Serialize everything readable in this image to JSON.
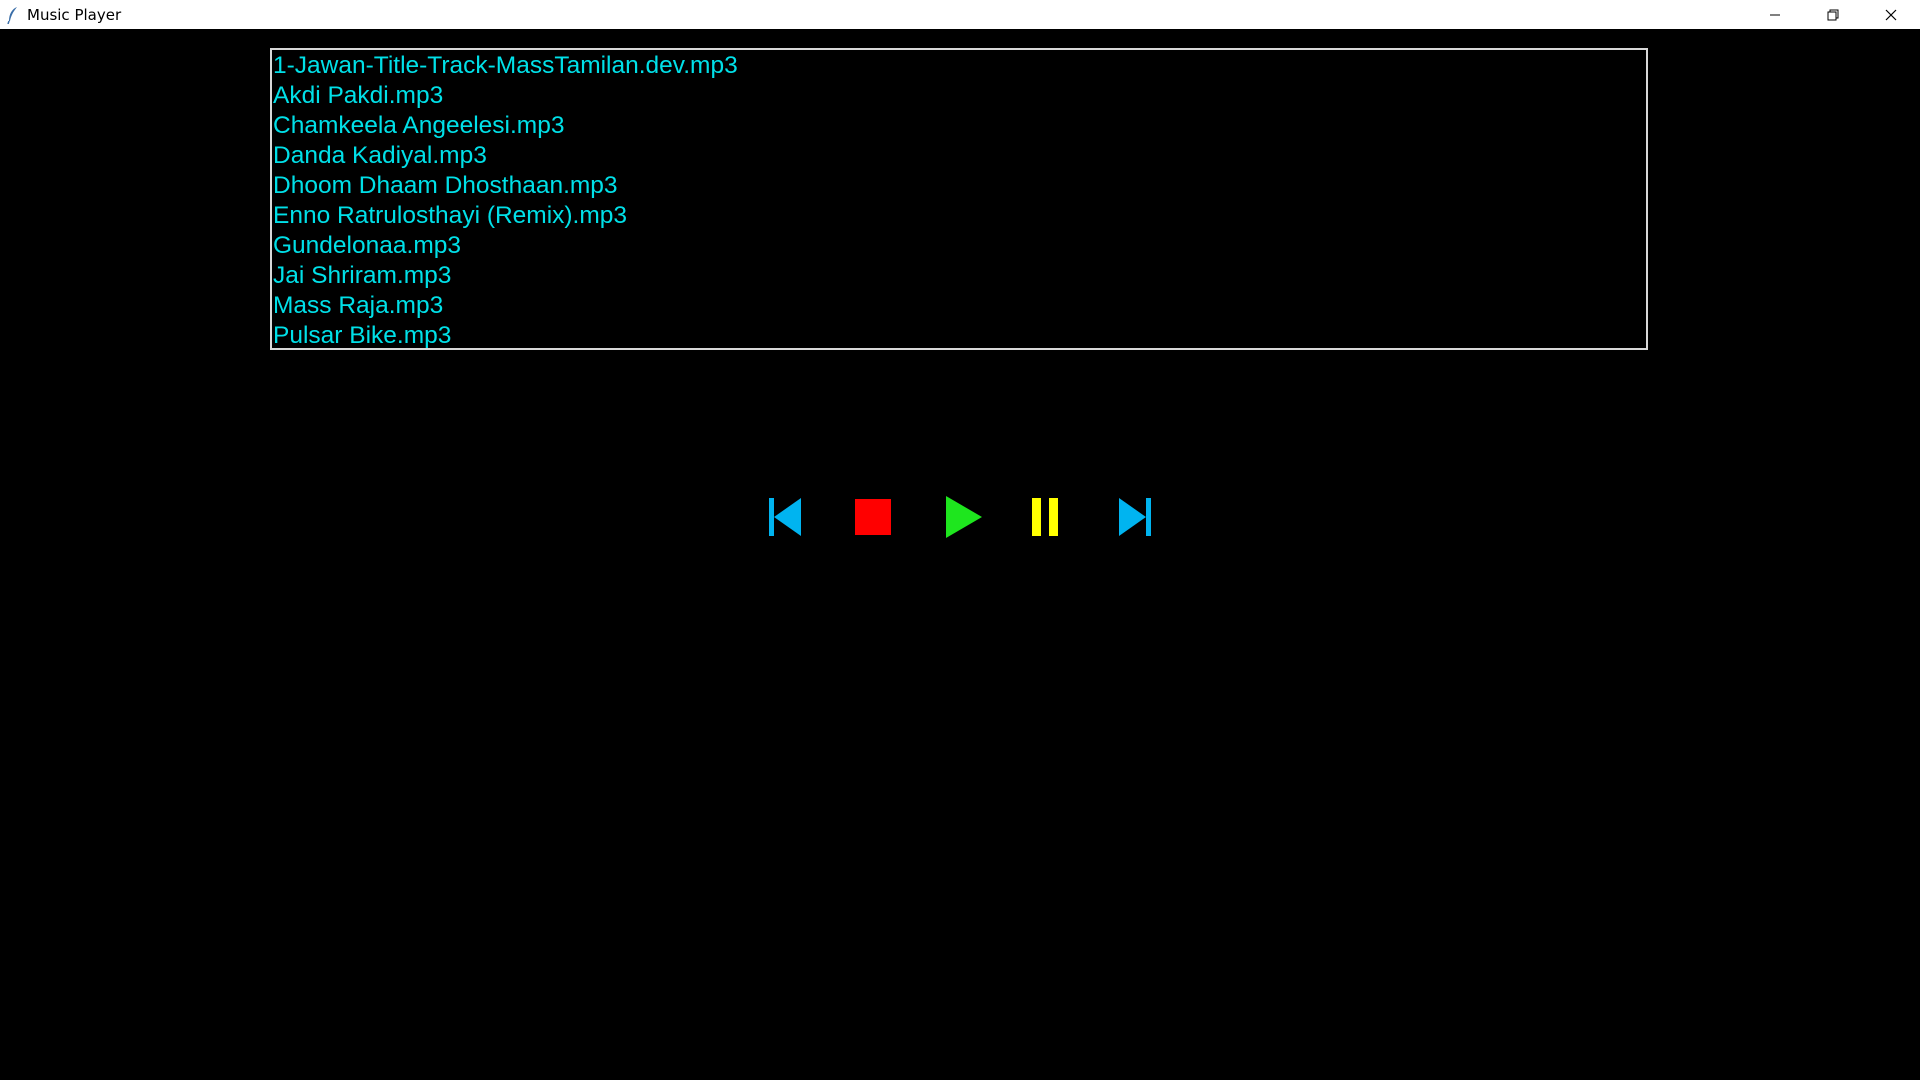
{
  "window": {
    "title": "Music Player"
  },
  "playlist": {
    "songs": [
      "1-Jawan-Title-Track-MassTamilan.dev.mp3",
      "Akdi Pakdi.mp3",
      "Chamkeela Angeelesi.mp3",
      "Danda Kadiyal.mp3",
      "Dhoom Dhaam Dhosthaan.mp3",
      "Enno Ratrulosthayi (Remix).mp3",
      "Gundelonaa.mp3",
      "Jai Shriram.mp3",
      "Mass Raja.mp3",
      "Pulsar Bike.mp3"
    ],
    "text_color": "#00e0e8"
  },
  "controls": {
    "icons": [
      "previous-icon",
      "stop-icon",
      "play-icon",
      "pause-icon",
      "next-icon"
    ],
    "colors": {
      "previous": "#00b4f0",
      "stop": "#ff0000",
      "play": "#1ee61e",
      "pause": "#ffff00",
      "next": "#00b4f0"
    }
  }
}
